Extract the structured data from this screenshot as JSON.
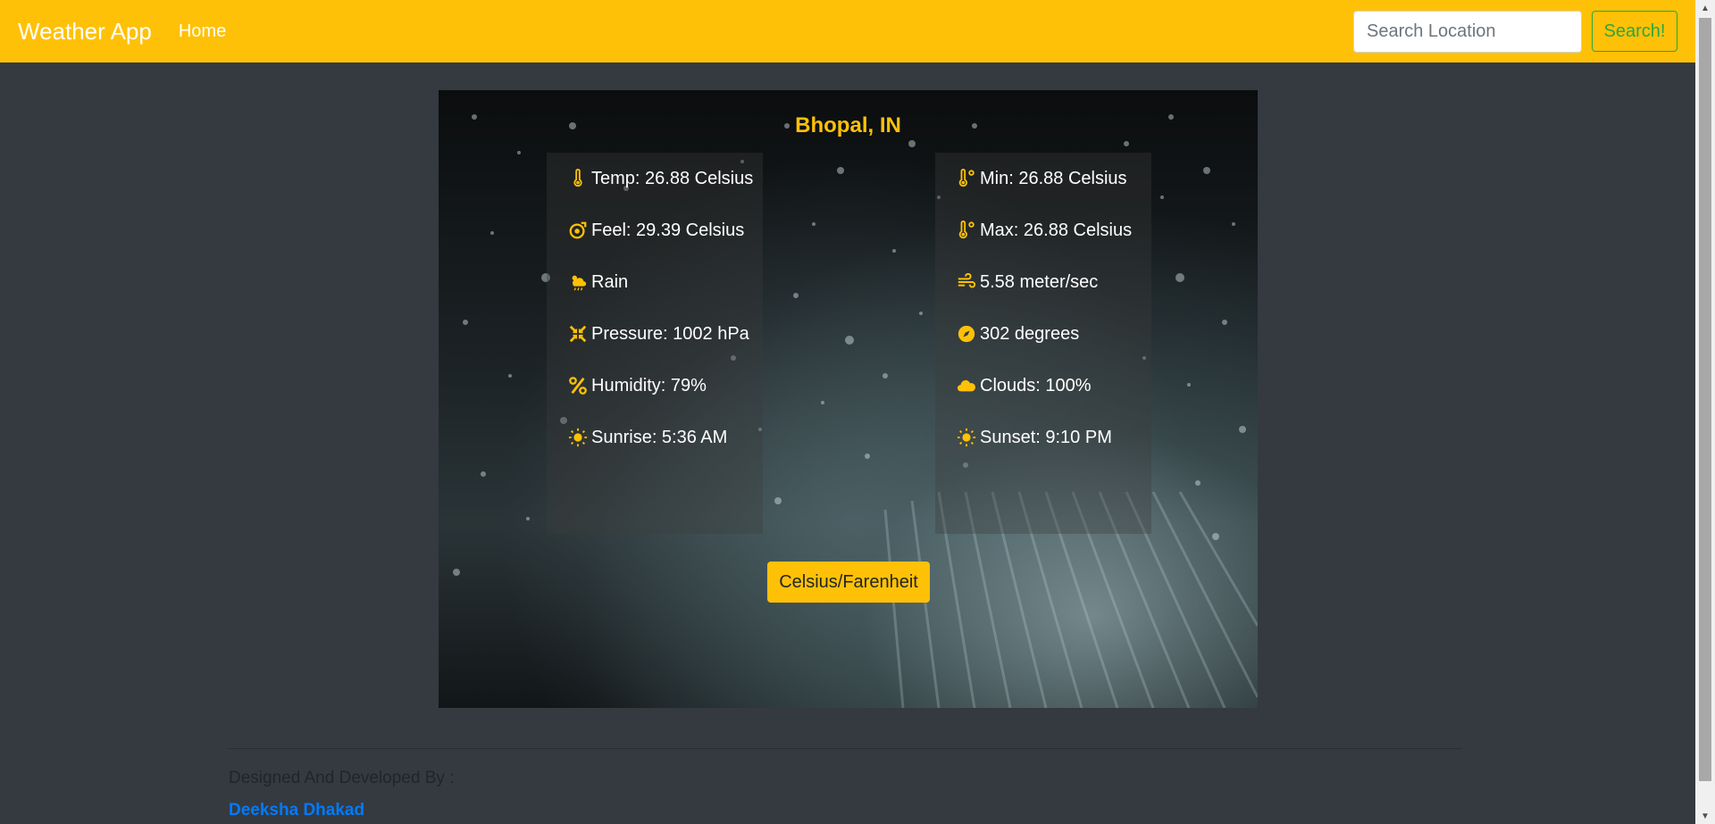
{
  "navbar": {
    "brand": "Weather App",
    "home_link": "Home",
    "search_placeholder": "Search Location",
    "search_button": "Search!"
  },
  "weather": {
    "location": "Bhopal, IN",
    "left_panel": [
      {
        "icon": "thermometer-icon",
        "text": "Temp: 26.88 Celsius"
      },
      {
        "icon": "feels-like-icon",
        "text": "Feel: 29.39 Celsius"
      },
      {
        "icon": "cloud-rain-sun-icon",
        "text": "Rain"
      },
      {
        "icon": "pressure-icon",
        "text": "Pressure: 1002 hPa"
      },
      {
        "icon": "percent-icon",
        "text": "Humidity: 79%"
      },
      {
        "icon": "sun-icon",
        "text": "Sunrise: 5:36 AM"
      }
    ],
    "right_panel": [
      {
        "icon": "thermometer-degree-icon",
        "text": "Min: 26.88 Celsius"
      },
      {
        "icon": "thermometer-degree-icon",
        "text": "Max: 26.88 Celsius"
      },
      {
        "icon": "wind-icon",
        "text": "5.58 meter/sec"
      },
      {
        "icon": "compass-icon",
        "text": "302 degrees"
      },
      {
        "icon": "cloud-icon",
        "text": "Clouds: 100%"
      },
      {
        "icon": "sun-icon",
        "text": "Sunset: 9:10 PM"
      }
    ],
    "unit_toggle": "Celsius/Farenheit"
  },
  "footer": {
    "label": "Designed And Developed By :",
    "author": "Deeksha Dhakad"
  },
  "colors": {
    "accent": "#ffc107",
    "background": "#343a40",
    "search_button": "#28a745",
    "author_link": "#007bff"
  }
}
